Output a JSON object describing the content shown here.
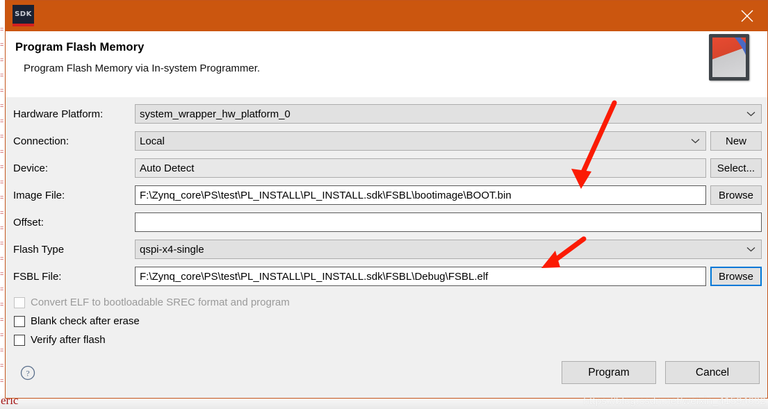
{
  "window": {
    "app_icon_label": "SDK",
    "close_icon": "close-icon",
    "logo_icon": "xilinx-logo-icon"
  },
  "header": {
    "title": "Program Flash Memory",
    "subtitle": "Program Flash Memory via In-system Programmer."
  },
  "form": {
    "rows": [
      {
        "label": "Hardware Platform:",
        "value": "system_wrapper_hw_platform_0",
        "kind": "combo",
        "button": null
      },
      {
        "label": "Connection:",
        "value": "Local",
        "kind": "combo",
        "button": "New"
      },
      {
        "label": "Device:",
        "value": "Auto Detect",
        "kind": "readonly",
        "button": "Select..."
      },
      {
        "label": "Image File:",
        "value": "F:\\Zynq_core\\PS\\test\\PL_INSTALL\\PL_INSTALL.sdk\\FSBL\\bootimage\\BOOT.bin",
        "kind": "text",
        "button": "Browse"
      },
      {
        "label": "Offset:",
        "value": "",
        "kind": "text",
        "button": null
      },
      {
        "label": "Flash Type",
        "value": "qspi-x4-single",
        "kind": "combo",
        "button": null
      },
      {
        "label": "FSBL File:",
        "value": "F:\\Zynq_core\\PS\\test\\PL_INSTALL\\PL_INSTALL.sdk\\FSBL\\Debug\\FSBL.elf",
        "kind": "text",
        "button": "Browse"
      }
    ],
    "checkboxes": [
      {
        "label": "Convert ELF to bootloadable SREC format and program",
        "checked": false,
        "enabled": false
      },
      {
        "label": "Blank check after erase",
        "checked": false,
        "enabled": true
      },
      {
        "label": "Verify after flash",
        "checked": false,
        "enabled": true
      }
    ]
  },
  "footer": {
    "help_icon": "help-icon",
    "program_label": "Program",
    "cancel_label": "Cancel",
    "watermark": "https://blog.csdn.net/weixin_41594632"
  },
  "background": {
    "bottom_text": "eric"
  },
  "colors": {
    "titlebar": "#cb560f",
    "dialog_bg": "#f0f0f0",
    "annotation": "#fb1b04",
    "focus": "#0078d7"
  }
}
